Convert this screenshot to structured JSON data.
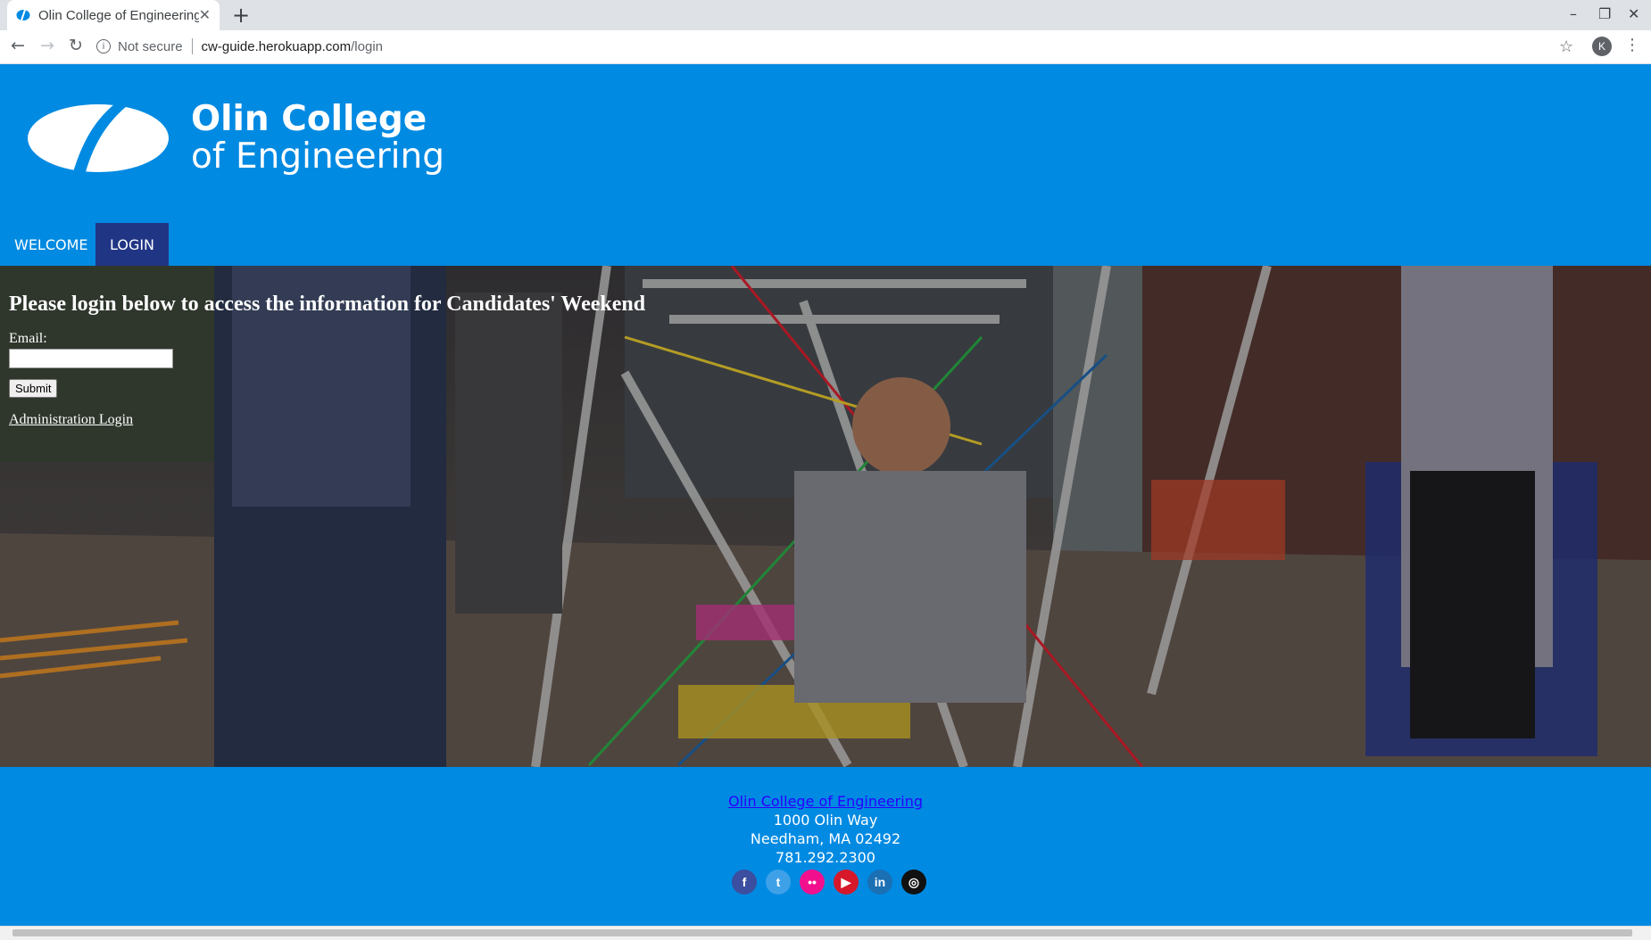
{
  "browser": {
    "tab_title": "Olin College of Engineering",
    "tab_close": "✕",
    "new_tab": "+",
    "not_secure": "Not secure",
    "url_host": "cw-guide.herokuapp.com",
    "url_path": "/login",
    "profile_initial": "K"
  },
  "header": {
    "logo_line1": "Olin College",
    "logo_line2": "of Engineering"
  },
  "nav": {
    "items": [
      {
        "label": "WELCOME"
      },
      {
        "label": "LOGIN"
      }
    ]
  },
  "login": {
    "title": "Please login below to access the information for Candidates' Weekend",
    "email_label": "Email:",
    "email_value": "",
    "submit_label": "Submit",
    "admin_link": "Administration Login"
  },
  "footer": {
    "college_link": "Olin College of Engineering",
    "address1": "1000 Olin Way",
    "address2": "Needham, MA 02492",
    "phone": "781.292.2300",
    "social": [
      {
        "icon": "facebook-icon",
        "glyph": "f",
        "color": "#3b4e9f"
      },
      {
        "icon": "twitter-icon",
        "glyph": "t",
        "color": "#3ea1e8"
      },
      {
        "icon": "flickr-icon",
        "glyph": "••",
        "color": "#f2108e"
      },
      {
        "icon": "youtube-icon",
        "glyph": "▶",
        "color": "#d6182a"
      },
      {
        "icon": "linkedin-icon",
        "glyph": "in",
        "color": "#1b6fb3"
      },
      {
        "icon": "instagram-icon",
        "glyph": "◎",
        "color": "#111111"
      }
    ]
  },
  "colors": {
    "brand_blue": "#008ae2",
    "nav_active": "#213585"
  }
}
